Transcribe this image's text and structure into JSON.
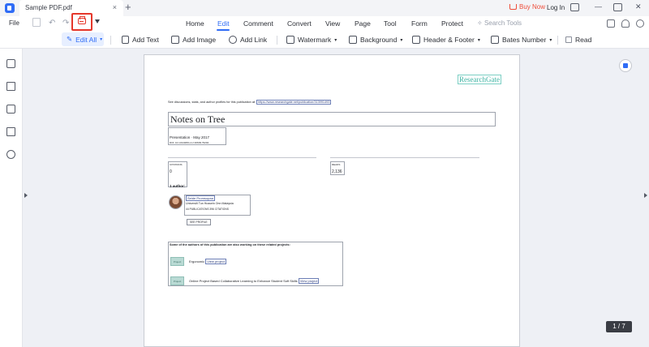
{
  "titlebar": {
    "tab_title": "Sample PDF.pdf",
    "close_glyph": "×",
    "new_tab_glyph": "+",
    "buy_now": "Buy Now",
    "login": "Log In",
    "minimize_glyph": "—",
    "close_window_glyph": "✕",
    "accent": "#2f6cf6",
    "buy_color": "#ee4d3a"
  },
  "menubar": {
    "file": "File",
    "undo_glyph": "↶",
    "redo_glyph": "↷",
    "tabs": [
      "Home",
      "Edit",
      "Comment",
      "Convert",
      "View",
      "Page",
      "Tool",
      "Form",
      "Protect"
    ],
    "active_tab": "Edit",
    "search_placeholder": "Search Tools"
  },
  "toolbar": {
    "edit_all": "Edit All",
    "add_text": "Add Text",
    "add_image": "Add Image",
    "add_link": "Add Link",
    "watermark": "Watermark",
    "background": "Background",
    "header_footer": "Header & Footer",
    "bates_number": "Bates Number",
    "read": "Read"
  },
  "document": {
    "logo": "ResearchGate",
    "discussion_line": "See discussions, stats, and author profiles for this publication at:",
    "discussion_url": "https://www.researchgate.net/publication/313991493",
    "title": "Notes on Tree",
    "presentation": "Presentation · May 2017",
    "doi": "DOI: 10.13140/RG.2.2.30609.79204",
    "citations_label": "CITATIONS",
    "citations_value": "0",
    "reads_label": "READS",
    "reads_value": "2,136",
    "authors_label": "1 author:",
    "author_name": "Seide Promsopaa",
    "author_affiliation": "Universiti Tun Hussein Onn Malaysia",
    "author_stats": "44 PUBLICATIONS   396 CITATIONS",
    "see_profile": "SEE PROFILE",
    "related_heading": "Some of the authors of this publication are also working on these related projects:",
    "project1": "Ergonomic",
    "project2": "Online Project Based Collaborative Learning to Enhance Student Soft Skills",
    "view_project": "View project",
    "project_thumb": "Project"
  },
  "status": {
    "page_indicator": "1 / 7"
  }
}
